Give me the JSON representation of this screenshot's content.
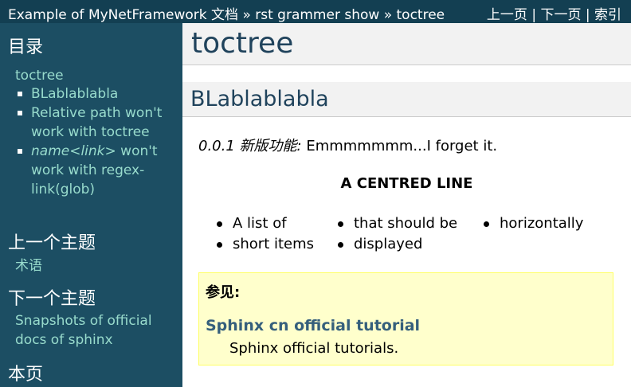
{
  "topbar": {
    "crumbs": [
      "Example of MyNetFramework 文档",
      "rst grammer show",
      "toctree"
    ],
    "crumb_sep": "»",
    "relnav": [
      "上一页",
      "下一页",
      "索引"
    ],
    "relnav_sep": "|"
  },
  "sidebar": {
    "toc_heading": "目录",
    "toc_root": "toctree",
    "toc_items": [
      {
        "text": "BLablablabla"
      },
      {
        "text": "Relative path won't work with toctree"
      },
      {
        "em": "name<link>",
        "text": " won't work with regex-link(glob)"
      }
    ],
    "prev_heading": "上一个主题",
    "prev_link": "术语",
    "next_heading": "下一个主题",
    "next_link": "Snapshots of official docs of sphinx",
    "page_heading": "本页"
  },
  "main": {
    "title": "toctree",
    "section_title": "BLablablabla",
    "versionadded_label": "0.0.1 新版功能:",
    "versionadded_text": " Emmmmmmm...I forget it.",
    "centered": "A CENTRED LINE",
    "hlist": [
      [
        "A list of",
        "short items"
      ],
      [
        "that should be",
        "displayed"
      ],
      [
        "horizontally"
      ]
    ],
    "seealso": {
      "title": "参见:",
      "link": "Sphinx cn official tutorial",
      "desc": "Sphinx official tutorials."
    }
  }
}
